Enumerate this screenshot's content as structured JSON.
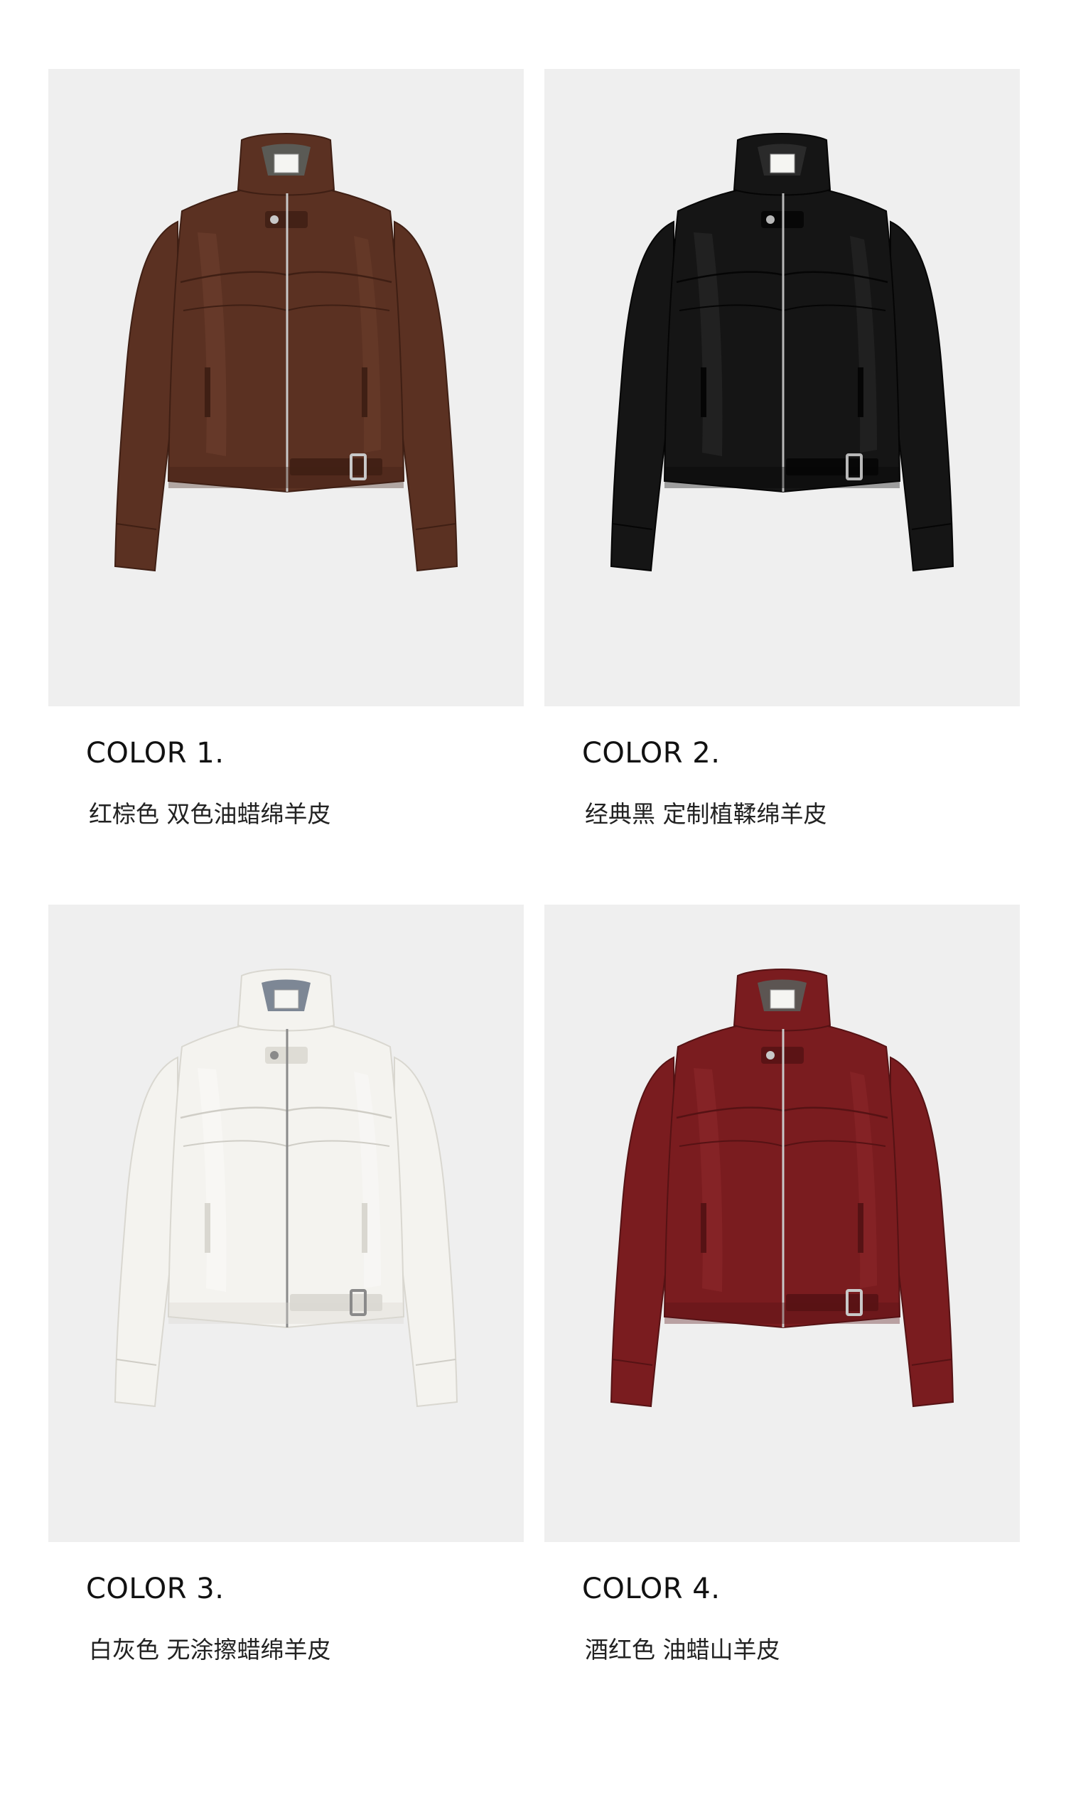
{
  "variants": [
    {
      "title": "COLOR 1.",
      "description": "红棕色 双色油蜡绵羊皮",
      "color": "#5b3122",
      "shade": "#3f1f14",
      "highlight": "#7a4a36",
      "lining": "#5a5a55",
      "hardware": "#c8c8c8"
    },
    {
      "title": "COLOR 2.",
      "description": "经典黑 定制植鞣绵羊皮",
      "color": "#151515",
      "shade": "#050505",
      "highlight": "#3a3a3a",
      "lining": "#2a2a2a",
      "hardware": "#b8b8b8"
    },
    {
      "title": "COLOR 3.",
      "description": "白灰色 无涂擦蜡绵羊皮",
      "color": "#f4f3ef",
      "shade": "#d9d7d0",
      "highlight": "#ffffff",
      "lining": "#7d8795",
      "hardware": "#8a8a8a"
    },
    {
      "title": "COLOR 4.",
      "description": "酒红色 油蜡山羊皮",
      "color": "#7a1c1f",
      "shade": "#561214",
      "highlight": "#9b3134",
      "lining": "#5c5552",
      "hardware": "#c8c8c8"
    }
  ]
}
